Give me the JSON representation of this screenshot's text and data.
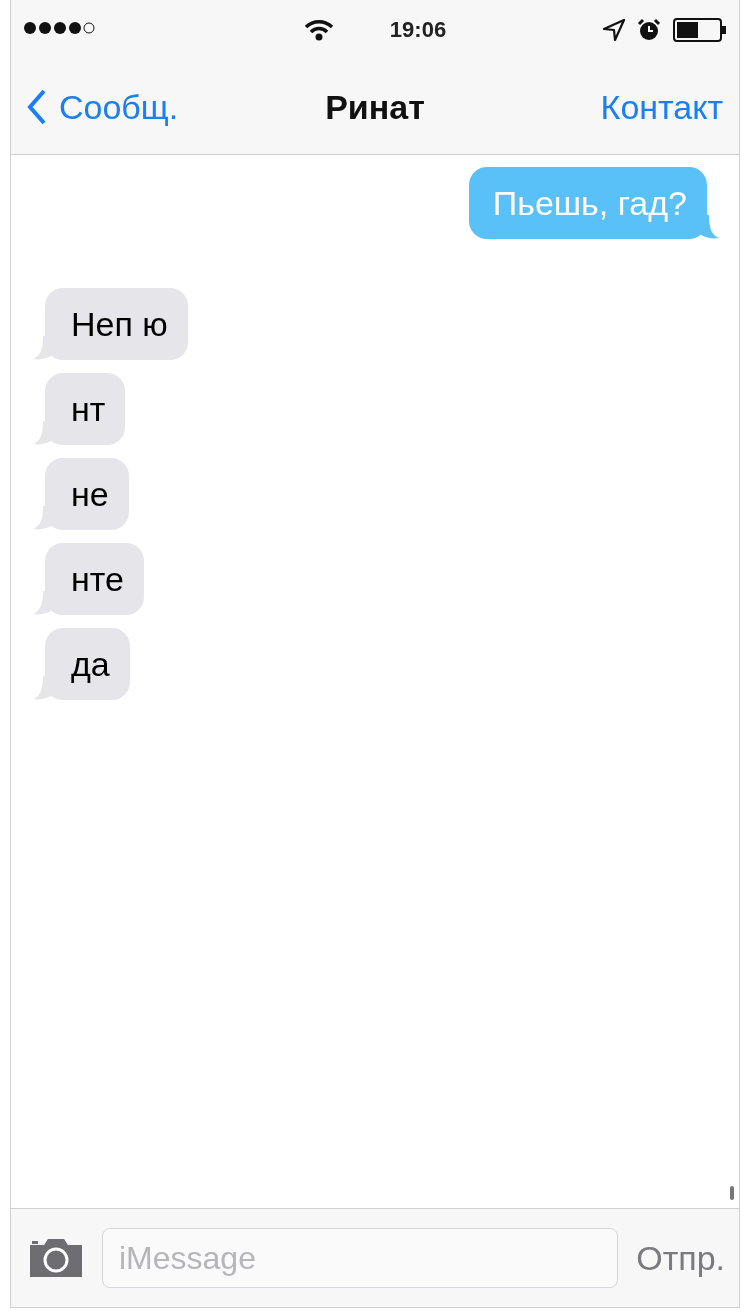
{
  "status_bar": {
    "time": "19:06"
  },
  "nav": {
    "back": "Сообщ.",
    "title": "Ринат",
    "action": "Контакт"
  },
  "messages": [
    {
      "kind": "outgoing",
      "text": "Пьешь, гад?"
    },
    {
      "kind": "incoming",
      "text": "Неп ю"
    },
    {
      "kind": "incoming",
      "text": "нт"
    },
    {
      "kind": "incoming",
      "text": "не"
    },
    {
      "kind": "incoming",
      "text": "нте"
    },
    {
      "kind": "incoming",
      "text": "да"
    }
  ],
  "composer": {
    "placeholder": "iMessage",
    "send": "Отпр.",
    "send_disabled": true
  }
}
